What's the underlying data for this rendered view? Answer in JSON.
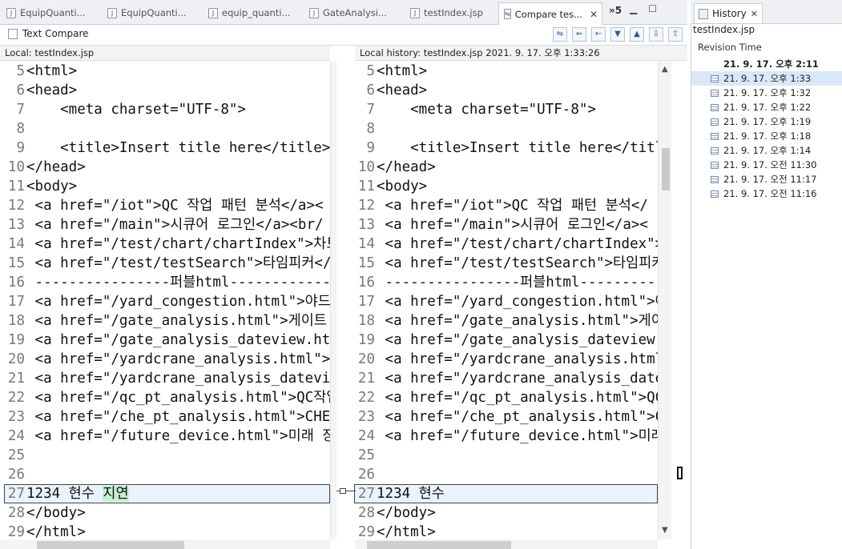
{
  "tabs": [
    {
      "label": "EquipQuanti...",
      "icon": "jsp-file-icon"
    },
    {
      "label": "EquipQuanti...",
      "icon": "java-file-icon"
    },
    {
      "label": "equip_quanti...",
      "icon": "jsp-file-icon"
    },
    {
      "label": "GateAnalysi...",
      "icon": "java-file-icon"
    },
    {
      "label": "testIndex.jsp",
      "icon": "jsp-file-icon"
    },
    {
      "label": "Compare tes...",
      "icon": "compare-icon",
      "active": true
    }
  ],
  "overflow_label": "»5",
  "view_title": "Text Compare",
  "left_header": "Local: testIndex.jsp",
  "right_header": "Local history: testIndex.jsp 2021. 9. 17. 오후 1:33:26",
  "left_lines": [
    {
      "n": "5",
      "t": "<html>"
    },
    {
      "n": "6",
      "t": "<head>"
    },
    {
      "n": "7",
      "t": "    <meta charset=\"UTF-8\">"
    },
    {
      "n": "8",
      "t": ""
    },
    {
      "n": "9",
      "t": "    <title>Insert title here</title>"
    },
    {
      "n": "10",
      "t": "</head>"
    },
    {
      "n": "11",
      "t": "<body>"
    },
    {
      "n": "12",
      "t": " <a href=\"/iot\">QC 작업 패턴 분석</a><"
    },
    {
      "n": "13",
      "t": " <a href=\"/main\">시큐어 로그인</a><br/"
    },
    {
      "n": "14",
      "t": " <a href=\"/test/chart/chartIndex\">차트"
    },
    {
      "n": "15",
      "t": " <a href=\"/test/testSearch\">타임피커</"
    },
    {
      "n": "16",
      "t": " ----------------퍼블html-------------"
    },
    {
      "n": "17",
      "t": " <a href=\"/yard_congestion.html\">야드"
    },
    {
      "n": "18",
      "t": " <a href=\"/gate_analysis.html\">게이트"
    },
    {
      "n": "19",
      "t": " <a href=\"/gate_analysis_dateview.html"
    },
    {
      "n": "20",
      "t": " <a href=\"/yardcrane_analysis.html\">Ya"
    },
    {
      "n": "21",
      "t": " <a href=\"/yardcrane_analysis_dateview"
    },
    {
      "n": "22",
      "t": " <a href=\"/qc_pt_analysis.html\">QC작업"
    },
    {
      "n": "23",
      "t": " <a href=\"/che_pt_analysis.html\">CHE패"
    },
    {
      "n": "24",
      "t": " <a href=\"/future_device.html\">미래 장"
    },
    {
      "n": "25",
      "t": ""
    },
    {
      "n": "26",
      "t": ""
    },
    {
      "n": "27",
      "t": "1234 현수 ",
      "h": "지연",
      "diff": true
    },
    {
      "n": "28",
      "t": "</body>"
    },
    {
      "n": "29",
      "t": "</html>"
    }
  ],
  "right_lines": [
    {
      "n": "5",
      "t": "<html>"
    },
    {
      "n": "6",
      "t": "<head>"
    },
    {
      "n": "7",
      "t": "    <meta charset=\"UTF-8\">"
    },
    {
      "n": "8",
      "t": ""
    },
    {
      "n": "9",
      "t": "    <title>Insert title here</title"
    },
    {
      "n": "10",
      "t": "</head>"
    },
    {
      "n": "11",
      "t": "<body>"
    },
    {
      "n": "12",
      "t": " <a href=\"/iot\">QC 작업 패턴 분석</"
    },
    {
      "n": "13",
      "t": " <a href=\"/main\">시큐어 로그인</a><"
    },
    {
      "n": "14",
      "t": " <a href=\"/test/chart/chartIndex\">차"
    },
    {
      "n": "15",
      "t": " <a href=\"/test/testSearch\">타임피커"
    },
    {
      "n": "16",
      "t": " ----------------퍼블html----------"
    },
    {
      "n": "17",
      "t": " <a href=\"/yard_congestion.html\">야"
    },
    {
      "n": "18",
      "t": " <a href=\"/gate_analysis.html\">게이"
    },
    {
      "n": "19",
      "t": " <a href=\"/gate_analysis_dateview.h"
    },
    {
      "n": "20",
      "t": " <a href=\"/yardcrane_analysis.html\""
    },
    {
      "n": "21",
      "t": " <a href=\"/yardcrane_analysis_datev"
    },
    {
      "n": "22",
      "t": " <a href=\"/qc_pt_analysis.html\">QC작"
    },
    {
      "n": "23",
      "t": " <a href=\"/che_pt_analysis.html\">CHE"
    },
    {
      "n": "24",
      "t": " <a href=\"/future_device.html\">미래"
    },
    {
      "n": "25",
      "t": ""
    },
    {
      "n": "26",
      "t": ""
    },
    {
      "n": "27",
      "t": "1234 현수",
      "diff": true
    },
    {
      "n": "28",
      "t": "</body>"
    },
    {
      "n": "29",
      "t": "</html>"
    }
  ],
  "history": {
    "tab_label": "History",
    "file": "testIndex.jsp",
    "column_header": "Revision Time",
    "revisions": [
      {
        "time": "21. 9. 17. 오후 2:11",
        "current": true
      },
      {
        "time": "21. 9. 17. 오후 1:33",
        "selected": true
      },
      {
        "time": "21. 9. 17. 오후 1:32"
      },
      {
        "time": "21. 9. 17. 오후 1:22"
      },
      {
        "time": "21. 9. 17. 오후 1:19"
      },
      {
        "time": "21. 9. 17. 오후 1:18"
      },
      {
        "time": "21. 9. 17. 오후 1:14"
      },
      {
        "time": "21. 9. 17. 오전 11:30"
      },
      {
        "time": "21. 9. 17. 오전 11:17"
      },
      {
        "time": "21. 9. 17. 오전 11:16"
      }
    ]
  },
  "colors": {
    "diff_highlight": "#c6f0d0",
    "selection": "#d8e8f8"
  }
}
